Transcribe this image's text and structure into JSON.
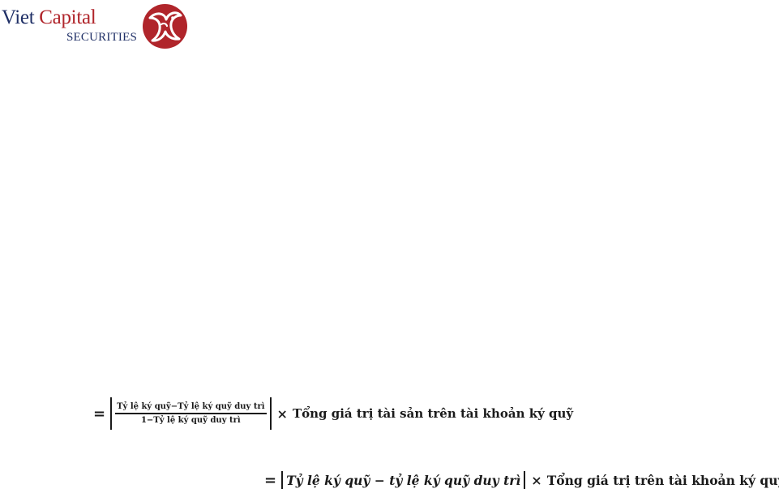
{
  "logo": {
    "brand_word1": "Viet",
    "brand_word2": "Capital",
    "brand_line2": "SECURITIES",
    "colors": {
      "navy": "#1f2f66",
      "red": "#b0252b"
    }
  },
  "formula1": {
    "equals": "=",
    "numerator": "Tỷ lệ ký quỹ−Tỷ lệ ký quỹ duy trì",
    "denominator": "1−Tỷ lệ ký quỹ duy trì",
    "times": "×",
    "rest": "Tổng giá trị tài sản trên tài khoản ký quỹ"
  },
  "formula2": {
    "equals": "=",
    "inner": "Tỷ lệ ký quỹ − tỷ lệ ký quỹ duy trì",
    "times": "×",
    "rest": "Tổng giá trị trên tài khoản ký quỹ"
  }
}
